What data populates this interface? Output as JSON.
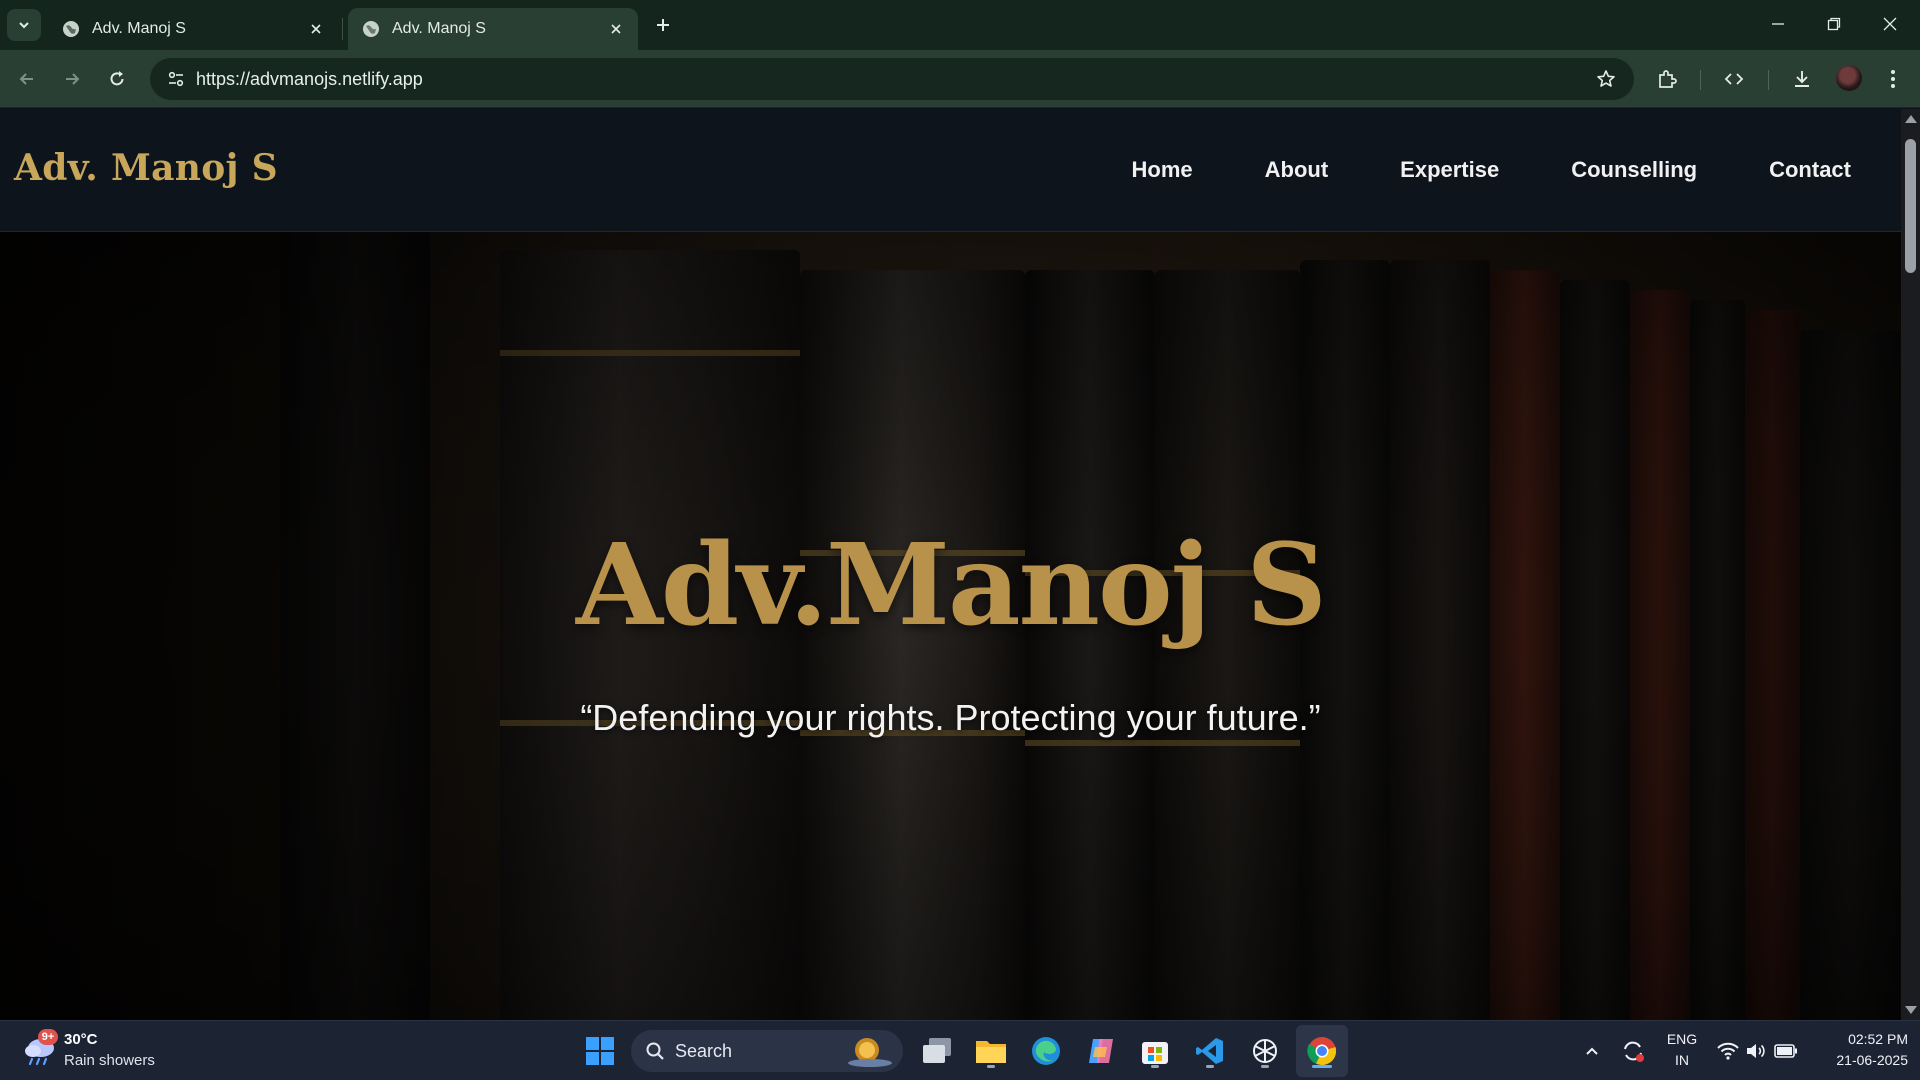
{
  "browser": {
    "tabs": [
      {
        "title": "Adv. Manoj S",
        "active": false
      },
      {
        "title": "Adv. Manoj S",
        "active": true
      }
    ],
    "url": "https://advmanojs.netlify.app"
  },
  "site": {
    "brand": "Adv. Manoj S",
    "nav": [
      "Home",
      "About",
      "Expertise",
      "Counselling",
      "Contact"
    ],
    "hero": {
      "title": "Adv.Manoj S",
      "tagline": "“Defending your rights. Protecting your future.”"
    },
    "colors": {
      "gold": "#c9a75a",
      "header_bg": "#0d141c",
      "nav_text": "#f1f1f1"
    }
  },
  "taskbar": {
    "weather": {
      "badge": "9+",
      "temp": "30°C",
      "desc": "Rain showers"
    },
    "search_placeholder": "Search",
    "lang": {
      "line1": "ENG",
      "line2": "IN"
    },
    "clock": {
      "time": "02:52 PM",
      "date": "21-06-2025"
    },
    "apps": [
      "start-icon",
      "task-view-icon",
      "file-explorer-icon",
      "edge-icon",
      "copilot-icon",
      "store-icon",
      "vscode-icon",
      "chatgpt-icon",
      "chrome-icon"
    ]
  }
}
